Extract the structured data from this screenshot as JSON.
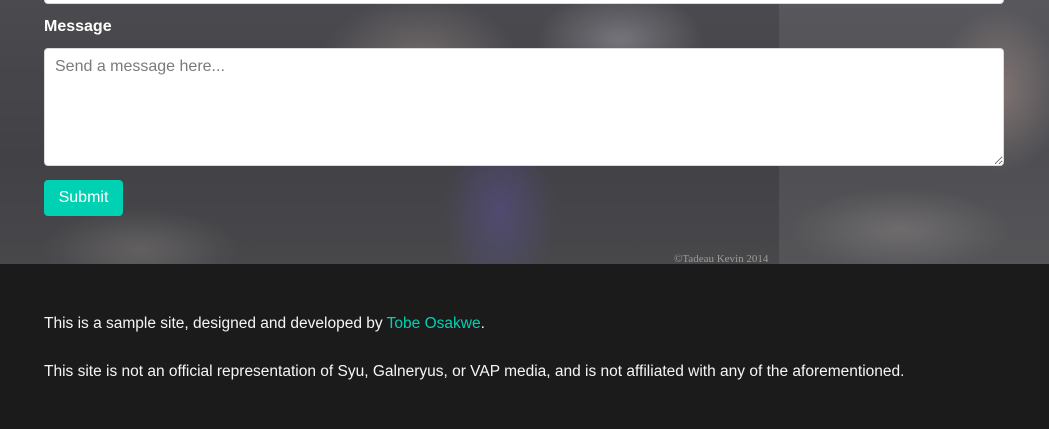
{
  "form": {
    "message_label": "Message",
    "message_placeholder": "Send a message here...",
    "message_value": "",
    "submit_label": "Submit"
  },
  "hero": {
    "watermark": "©Tadeau Kevin 2014"
  },
  "footer": {
    "line1_prefix": "This is a sample site, designed and developed by ",
    "author_link": "Tobe Osakwe",
    "line1_suffix": ".",
    "line2": "This site is not an official representation of Syu, Galneryus, or VAP media, and is not affiliated with any of the aforementioned."
  },
  "colors": {
    "accent": "#00d1b2",
    "footer_bg": "#1b1b1b"
  }
}
